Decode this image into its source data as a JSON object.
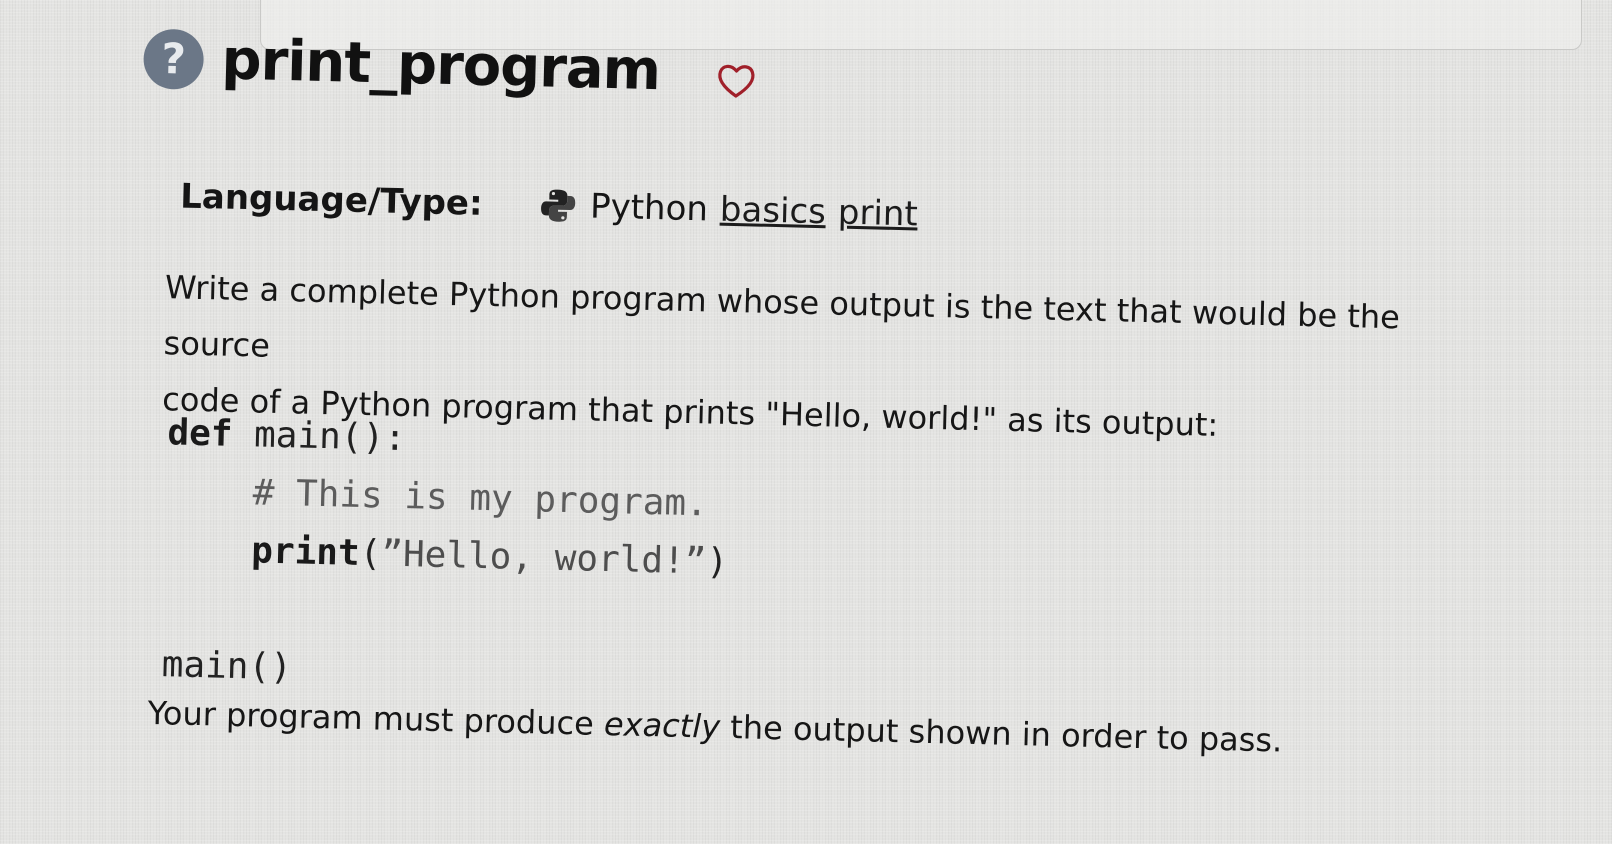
{
  "problem": {
    "title": "print_program",
    "help_icon_glyph": "?",
    "favorite_icon": "heart-outline-icon"
  },
  "meta": {
    "label": "Language/Type:",
    "language_icon": "python-logo-icon",
    "language": "Python",
    "tags": [
      "basics",
      "print"
    ]
  },
  "description": {
    "line1": "Write a complete Python program whose output is the text that would be the source",
    "line2": "code of a Python program that prints \"Hello, world!\" as its output:"
  },
  "code": {
    "line1_kw": "def",
    "line1_rest": " main():",
    "line2_indent": "    ",
    "line2_comment": "# This is my program.",
    "line3_indent": "    ",
    "line3_func": "print",
    "line3_open": "(",
    "line3_str": "”Hello, world!”",
    "line3_close": ")",
    "line5": "main()"
  },
  "outro": {
    "before": "Your program must produce ",
    "emphasis": "exactly",
    "after": " the output shown in order to pass."
  },
  "colors": {
    "help_icon_bg": "#6b7787",
    "heart_stroke": "#a0202a"
  }
}
